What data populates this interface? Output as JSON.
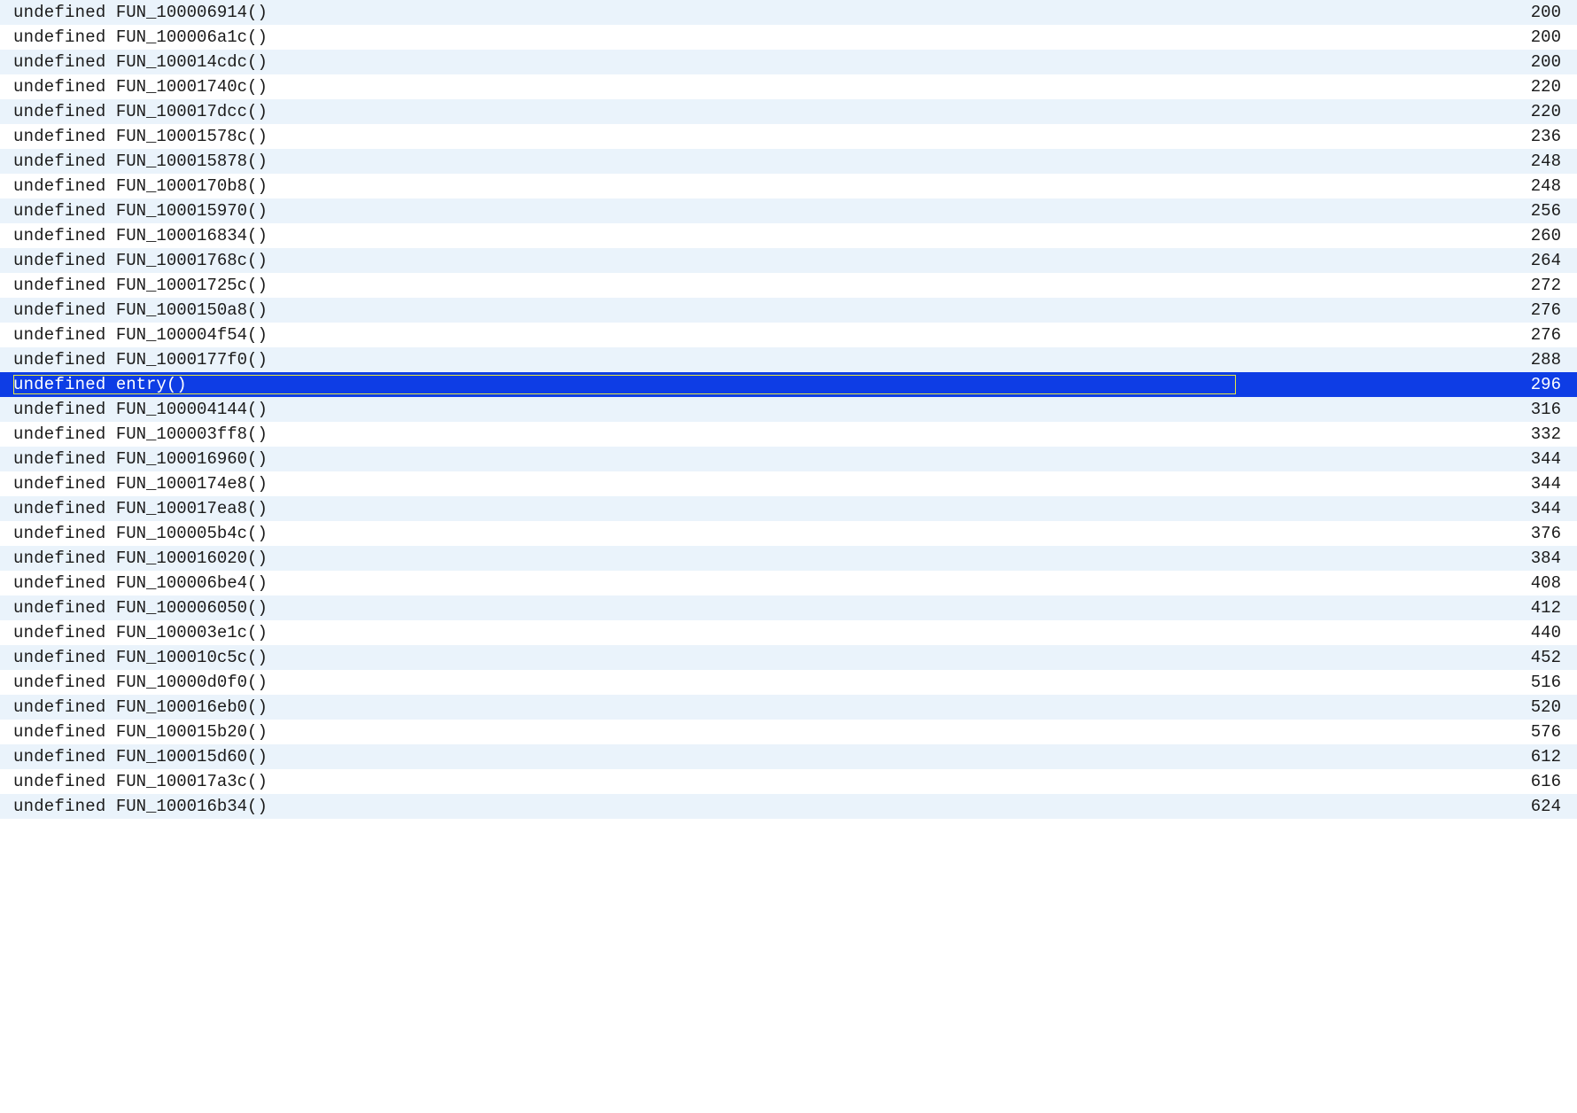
{
  "functions": [
    {
      "type": "undefined",
      "name": "FUN_100006914()",
      "size": "200",
      "selected": false
    },
    {
      "type": "undefined",
      "name": "FUN_100006a1c()",
      "size": "200",
      "selected": false
    },
    {
      "type": "undefined",
      "name": "FUN_100014cdc()",
      "size": "200",
      "selected": false
    },
    {
      "type": "undefined",
      "name": "FUN_10001740c()",
      "size": "220",
      "selected": false
    },
    {
      "type": "undefined",
      "name": "FUN_100017dcc()",
      "size": "220",
      "selected": false
    },
    {
      "type": "undefined",
      "name": "FUN_10001578c()",
      "size": "236",
      "selected": false
    },
    {
      "type": "undefined",
      "name": "FUN_100015878()",
      "size": "248",
      "selected": false
    },
    {
      "type": "undefined",
      "name": "FUN_1000170b8()",
      "size": "248",
      "selected": false
    },
    {
      "type": "undefined",
      "name": "FUN_100015970()",
      "size": "256",
      "selected": false
    },
    {
      "type": "undefined",
      "name": "FUN_100016834()",
      "size": "260",
      "selected": false
    },
    {
      "type": "undefined",
      "name": "FUN_10001768c()",
      "size": "264",
      "selected": false
    },
    {
      "type": "undefined",
      "name": "FUN_10001725c()",
      "size": "272",
      "selected": false
    },
    {
      "type": "undefined",
      "name": "FUN_1000150a8()",
      "size": "276",
      "selected": false
    },
    {
      "type": "undefined",
      "name": "FUN_100004f54()",
      "size": "276",
      "selected": false
    },
    {
      "type": "undefined",
      "name": "FUN_1000177f0()",
      "size": "288",
      "selected": false
    },
    {
      "type": "undefined",
      "name": "entry()",
      "size": "296",
      "selected": true
    },
    {
      "type": "undefined",
      "name": "FUN_100004144()",
      "size": "316",
      "selected": false
    },
    {
      "type": "undefined",
      "name": "FUN_100003ff8()",
      "size": "332",
      "selected": false
    },
    {
      "type": "undefined",
      "name": "FUN_100016960()",
      "size": "344",
      "selected": false
    },
    {
      "type": "undefined",
      "name": "FUN_1000174e8()",
      "size": "344",
      "selected": false
    },
    {
      "type": "undefined",
      "name": "FUN_100017ea8()",
      "size": "344",
      "selected": false
    },
    {
      "type": "undefined",
      "name": "FUN_100005b4c()",
      "size": "376",
      "selected": false
    },
    {
      "type": "undefined",
      "name": "FUN_100016020()",
      "size": "384",
      "selected": false
    },
    {
      "type": "undefined",
      "name": "FUN_100006be4()",
      "size": "408",
      "selected": false
    },
    {
      "type": "undefined",
      "name": "FUN_100006050()",
      "size": "412",
      "selected": false
    },
    {
      "type": "undefined",
      "name": "FUN_100003e1c()",
      "size": "440",
      "selected": false
    },
    {
      "type": "undefined",
      "name": "FUN_100010c5c()",
      "size": "452",
      "selected": false
    },
    {
      "type": "undefined",
      "name": "FUN_10000d0f0()",
      "size": "516",
      "selected": false
    },
    {
      "type": "undefined",
      "name": "FUN_100016eb0()",
      "size": "520",
      "selected": false
    },
    {
      "type": "undefined",
      "name": "FUN_100015b20()",
      "size": "576",
      "selected": false
    },
    {
      "type": "undefined",
      "name": "FUN_100015d60()",
      "size": "612",
      "selected": false
    },
    {
      "type": "undefined",
      "name": "FUN_100017a3c()",
      "size": "616",
      "selected": false
    },
    {
      "type": "undefined",
      "name": "FUN_100016b34()",
      "size": "624",
      "selected": false
    }
  ]
}
